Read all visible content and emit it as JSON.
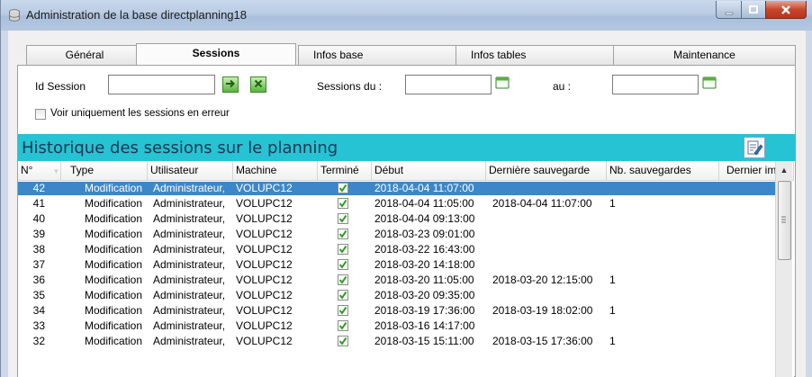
{
  "window": {
    "title": "Administration de la base directplanning18"
  },
  "tabs": [
    {
      "label": "Général",
      "active": false
    },
    {
      "label": "Sessions",
      "active": true
    },
    {
      "label": "Infos base",
      "active": false
    },
    {
      "label": "Infos tables",
      "active": false
    },
    {
      "label": "Maintenance",
      "active": false
    }
  ],
  "filters": {
    "id_session_label": "Id Session",
    "id_session_value": "",
    "sessions_from_label": "Sessions du :",
    "sessions_from_value": "",
    "to_label": "au :",
    "to_value": "",
    "only_errors_label": "Voir uniquement les sessions en erreur",
    "only_errors_checked": false
  },
  "section": {
    "title": "Historique des sessions sur le planning"
  },
  "grid": {
    "columns": [
      "N°",
      "Type",
      "Utilisateur",
      "Machine",
      "Terminé",
      "Début",
      "Dernière sauvegarde",
      "Nb. sauvegardes",
      "Dernier impo"
    ],
    "rows": [
      {
        "num": "42",
        "type": "Modification",
        "user": "Administrateur,",
        "machine": "VOLUPC12",
        "done": true,
        "start": "2018-04-04 11:07:00",
        "last_save": "",
        "saves": "",
        "selected": true
      },
      {
        "num": "41",
        "type": "Modification",
        "user": "Administrateur,",
        "machine": "VOLUPC12",
        "done": true,
        "start": "2018-04-04 11:05:00",
        "last_save": "2018-04-04 11:07:00",
        "saves": "1",
        "selected": false
      },
      {
        "num": "40",
        "type": "Modification",
        "user": "Administrateur,",
        "machine": "VOLUPC12",
        "done": true,
        "start": "2018-04-04 09:13:00",
        "last_save": "",
        "saves": "",
        "selected": false
      },
      {
        "num": "39",
        "type": "Modification",
        "user": "Administrateur,",
        "machine": "VOLUPC12",
        "done": true,
        "start": "2018-03-23 09:01:00",
        "last_save": "",
        "saves": "",
        "selected": false
      },
      {
        "num": "38",
        "type": "Modification",
        "user": "Administrateur,",
        "machine": "VOLUPC12",
        "done": true,
        "start": "2018-03-22 16:43:00",
        "last_save": "",
        "saves": "",
        "selected": false
      },
      {
        "num": "37",
        "type": "Modification",
        "user": "Administrateur,",
        "machine": "VOLUPC12",
        "done": true,
        "start": "2018-03-20 14:18:00",
        "last_save": "",
        "saves": "",
        "selected": false
      },
      {
        "num": "36",
        "type": "Modification",
        "user": "Administrateur,",
        "machine": "VOLUPC12",
        "done": true,
        "start": "2018-03-20 11:05:00",
        "last_save": "2018-03-20 12:15:00",
        "saves": "1",
        "selected": false
      },
      {
        "num": "35",
        "type": "Modification",
        "user": "Administrateur,",
        "machine": "VOLUPC12",
        "done": true,
        "start": "2018-03-20 09:35:00",
        "last_save": "",
        "saves": "",
        "selected": false
      },
      {
        "num": "34",
        "type": "Modification",
        "user": "Administrateur,",
        "machine": "VOLUPC12",
        "done": true,
        "start": "2018-03-19 17:36:00",
        "last_save": "2018-03-19 18:02:00",
        "saves": "1",
        "selected": false
      },
      {
        "num": "33",
        "type": "Modification",
        "user": "Administrateur,",
        "machine": "VOLUPC12",
        "done": true,
        "start": "2018-03-16 14:17:00",
        "last_save": "",
        "saves": "",
        "selected": false
      },
      {
        "num": "32",
        "type": "Modification",
        "user": "Administrateur,",
        "machine": "VOLUPC12",
        "done": true,
        "start": "2018-03-15 15:11:00",
        "last_save": "2018-03-15 17:36:00",
        "saves": "1",
        "selected": false
      }
    ]
  },
  "colors": {
    "banner": "#25c3d4",
    "selection": "#3d87c8",
    "check": "#2e9e1f"
  }
}
